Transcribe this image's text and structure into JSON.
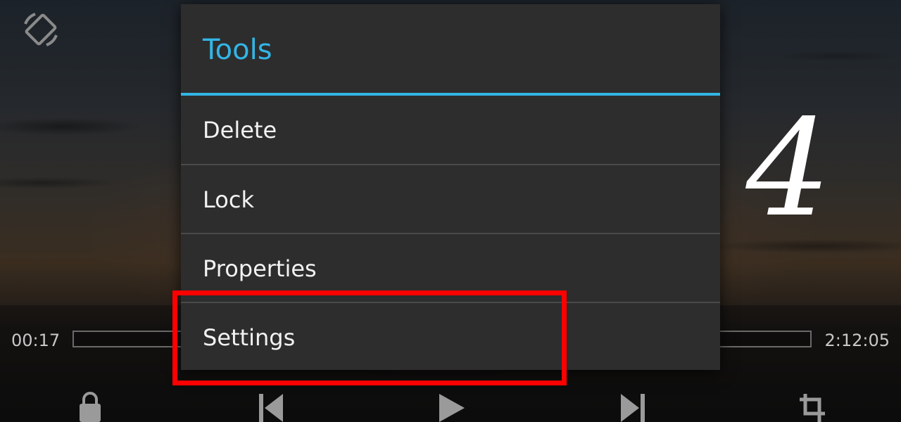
{
  "player": {
    "time_current": "00:17",
    "time_total": "2:12:05",
    "overlay_number": "4"
  },
  "dialog": {
    "title": "Tools",
    "items": [
      {
        "label": "Delete"
      },
      {
        "label": "Lock"
      },
      {
        "label": "Properties"
      },
      {
        "label": "Settings"
      }
    ],
    "accent_color": "#33b5e5",
    "highlighted_item": "Settings",
    "highlight_color": "#ff0000"
  },
  "controls": {
    "icons": [
      "lock-icon",
      "skip-previous-icon",
      "play-icon",
      "skip-next-icon",
      "crop-icon"
    ]
  }
}
